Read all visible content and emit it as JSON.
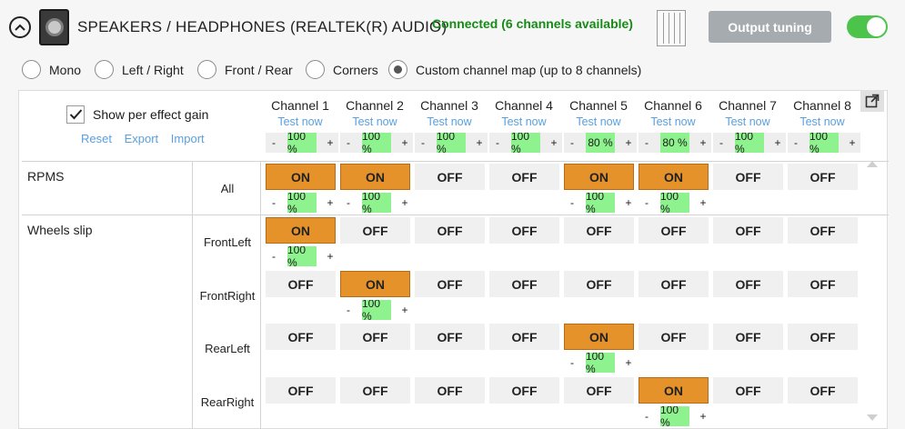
{
  "device": {
    "title": "SPEAKERS / HEADPHONES (REALTEK(R) AUDIO)",
    "status": "Connected (6 channels available)",
    "output_tuning_label": "Output tuning",
    "enabled": true
  },
  "modes": [
    {
      "label": "Mono",
      "selected": false
    },
    {
      "label": "Left / Right",
      "selected": false
    },
    {
      "label": "Front / Rear",
      "selected": false
    },
    {
      "label": "Corners",
      "selected": false
    },
    {
      "label": "Custom channel map (up to 8 channels)",
      "selected": true
    }
  ],
  "options": {
    "show_gain_label": "Show per effect gain",
    "show_gain_checked": true,
    "reset_label": "Reset",
    "export_label": "Export",
    "import_label": "Import"
  },
  "channels": [
    {
      "name": "Channel 1",
      "test": "Test now",
      "gain": "100 %"
    },
    {
      "name": "Channel 2",
      "test": "Test now",
      "gain": "100 %"
    },
    {
      "name": "Channel 3",
      "test": "Test now",
      "gain": "100 %"
    },
    {
      "name": "Channel 4",
      "test": "Test now",
      "gain": "100 %"
    },
    {
      "name": "Channel 5",
      "test": "Test now",
      "gain": "80 %"
    },
    {
      "name": "Channel 6",
      "test": "Test now",
      "gain": "80 %"
    },
    {
      "name": "Channel 7",
      "test": "Test now",
      "gain": "100 %"
    },
    {
      "name": "Channel 8",
      "test": "Test now",
      "gain": "100 %"
    }
  ],
  "labels": {
    "on": "ON",
    "off": "OFF",
    "minus": "-",
    "plus": "+"
  },
  "effects": [
    {
      "name": "RPMS",
      "rows": [
        {
          "sub": "All",
          "states": [
            true,
            true,
            false,
            false,
            true,
            true,
            false,
            false
          ],
          "gains": [
            "100 %",
            "100 %",
            null,
            null,
            "100 %",
            "100 %",
            null,
            null
          ]
        }
      ]
    },
    {
      "name": "Wheels slip",
      "rows": [
        {
          "sub": "FrontLeft",
          "states": [
            true,
            false,
            false,
            false,
            false,
            false,
            false,
            false
          ],
          "gains": [
            "100 %",
            null,
            null,
            null,
            null,
            null,
            null,
            null
          ]
        },
        {
          "sub": "FrontRight",
          "states": [
            false,
            true,
            false,
            false,
            false,
            false,
            false,
            false
          ],
          "gains": [
            null,
            "100 %",
            null,
            null,
            null,
            null,
            null,
            null
          ]
        },
        {
          "sub": "RearLeft",
          "states": [
            false,
            false,
            false,
            false,
            true,
            false,
            false,
            false
          ],
          "gains": [
            null,
            null,
            null,
            null,
            "100 %",
            null,
            null,
            null
          ]
        },
        {
          "sub": "RearRight",
          "states": [
            false,
            false,
            false,
            false,
            false,
            true,
            false,
            false
          ],
          "gains": [
            null,
            null,
            null,
            null,
            null,
            "100 %",
            null,
            null
          ]
        }
      ]
    }
  ]
}
